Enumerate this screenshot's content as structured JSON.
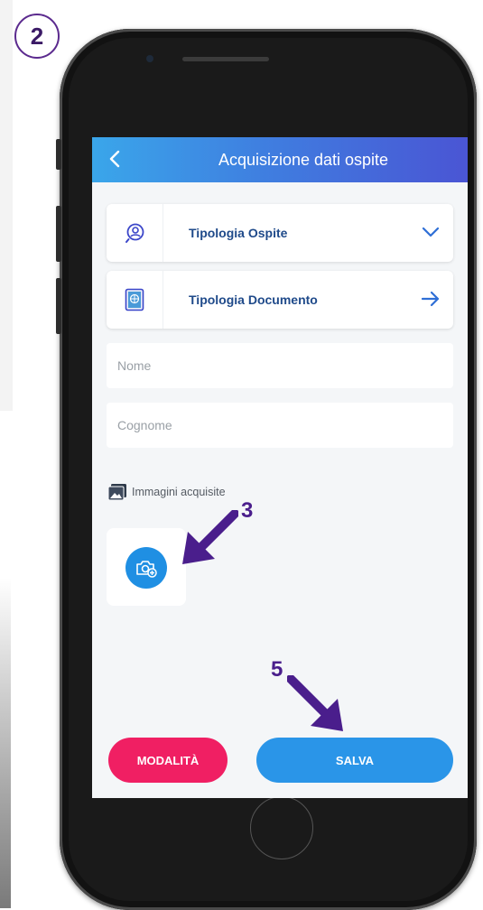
{
  "step_badge": "2",
  "header": {
    "title": "Acquisizione dati ospite"
  },
  "cards": [
    {
      "label": "Tipologia Ospite",
      "icon": "user-search-icon",
      "trailing": "chevron-down-icon"
    },
    {
      "label": "Tipologia Documento",
      "icon": "passport-icon",
      "trailing": "arrow-right-icon"
    }
  ],
  "fields": {
    "first_name_placeholder": "Nome",
    "last_name_placeholder": "Cognome"
  },
  "images": {
    "label": "Immagini acquisite",
    "add_icon": "add-photo-icon"
  },
  "buttons": {
    "mode_label": "MODALITÀ",
    "save_label": "SALVA"
  },
  "annotations": {
    "add_photo_step": "3",
    "save_step": "5"
  },
  "colors": {
    "header_start": "#3aa6ea",
    "header_end": "#4a55d4",
    "card_text": "#1f4a8a",
    "accent_blue": "#2a95e8",
    "mode_pink": "#f01f63",
    "annotation_purple": "#4a1e8c"
  }
}
